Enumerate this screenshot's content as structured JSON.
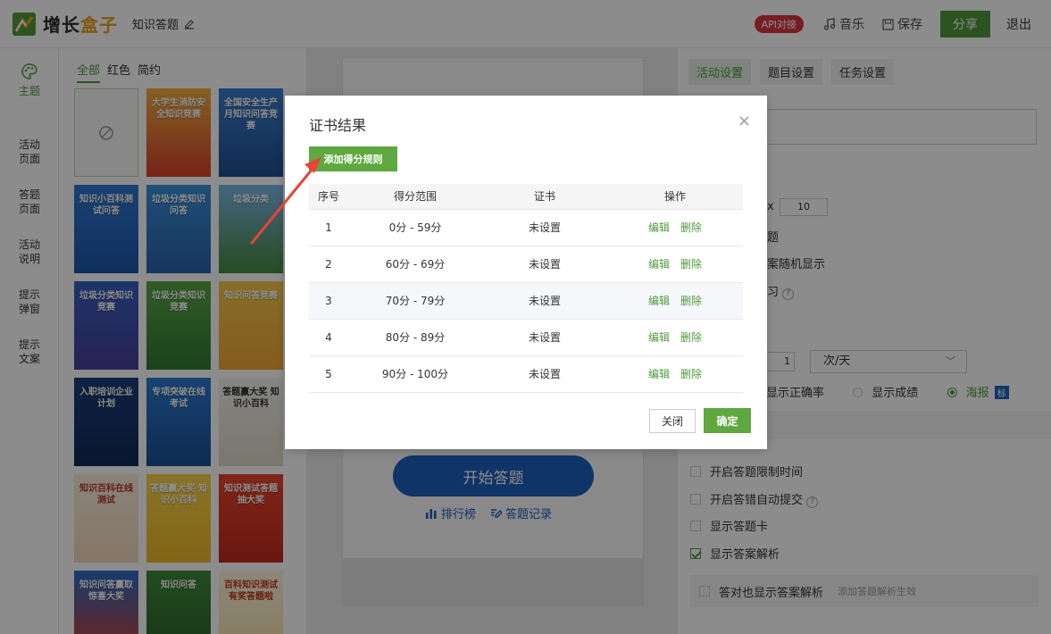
{
  "header": {
    "logo_text_a": "增长",
    "logo_text_b": "盒子",
    "project_title": "知识答题",
    "api_badge": "API对接",
    "music_label": "音乐",
    "save_label": "保存",
    "share_label": "分享",
    "exit_label": "退出"
  },
  "leftnav": {
    "items": [
      {
        "label_1": "主题",
        "label_2": ""
      },
      {
        "label_1": "活动",
        "label_2": "页面"
      },
      {
        "label_1": "答题",
        "label_2": "页面"
      },
      {
        "label_1": "活动",
        "label_2": "说明"
      },
      {
        "label_1": "提示",
        "label_2": "弹窗"
      },
      {
        "label_1": "提示",
        "label_2": "文案"
      }
    ]
  },
  "templates": {
    "tabs": [
      "全部",
      "红色",
      "简约"
    ],
    "items": [
      {
        "title": ""
      },
      {
        "title": "大学生消防安全知识竞赛"
      },
      {
        "title": "全国安全生产月知识问答竞赛"
      },
      {
        "title": "知识小百科测试问答"
      },
      {
        "title": "垃圾分类知识问答"
      },
      {
        "title": "垃圾分类"
      },
      {
        "title": "垃圾分类知识竞赛"
      },
      {
        "title": "垃圾分类知识竞赛"
      },
      {
        "title": "知识问答竞赛"
      },
      {
        "title": "入职培训企业计划"
      },
      {
        "title": "专项突破在线考试"
      },
      {
        "title": "答题赢大奖 知识小百科"
      },
      {
        "title": "知识百科在线测试"
      },
      {
        "title": "答题赢大奖 知识小百科"
      },
      {
        "title": "知识测试答题抽大奖"
      },
      {
        "title": "知识问答赢取惊喜大奖"
      },
      {
        "title": "知识问答"
      },
      {
        "title": "百科知识测试有奖答题啦"
      }
    ]
  },
  "preview": {
    "start_label": "开始答题",
    "rank_label": "排行榜",
    "record_label": "答题记录"
  },
  "settings": {
    "tabs": [
      "活动设置",
      "题目设置",
      "任务设置"
    ],
    "frag_x": "x",
    "num_value": "10",
    "frag_ti": "题",
    "frag_random": "案随机显示",
    "frag_practice": "习",
    "num_value2": "1",
    "select_value": "次/天",
    "radio_accuracy": "显示正确率",
    "radio_score": "显示成绩",
    "radio_poster": "海报",
    "poster_tag": "标",
    "check_time_limit": "开启答题限制时间",
    "check_auto_submit": "开启答错自动提交",
    "check_answer_card": "显示答题卡",
    "check_analysis": "显示答案解析",
    "sub_check_correct": "答对也显示答案解析",
    "sub_hint": "添加答题解析生效"
  },
  "modal": {
    "title": "证书结果",
    "add_rule_label": "添加得分规则",
    "columns": [
      "序号",
      "得分范围",
      "证书",
      "操作"
    ],
    "rows": [
      {
        "index": "1",
        "range": "0分 - 59分",
        "cert": "未设置",
        "edit": "编辑",
        "delete": "删除"
      },
      {
        "index": "2",
        "range": "60分 - 69分",
        "cert": "未设置",
        "edit": "编辑",
        "delete": "删除"
      },
      {
        "index": "3",
        "range": "70分 - 79分",
        "cert": "未设置",
        "edit": "编辑",
        "delete": "删除"
      },
      {
        "index": "4",
        "range": "80分 - 89分",
        "cert": "未设置",
        "edit": "编辑",
        "delete": "删除"
      },
      {
        "index": "5",
        "range": "90分 - 100分",
        "cert": "未设置",
        "edit": "编辑",
        "delete": "删除"
      }
    ],
    "close_label": "关闭",
    "ok_label": "确定"
  },
  "colors": {
    "brand_green": "#4f9a3c",
    "accent_blue": "#1c5fbd",
    "api_red": "#d9363e",
    "arrow_red": "#e8433a"
  }
}
